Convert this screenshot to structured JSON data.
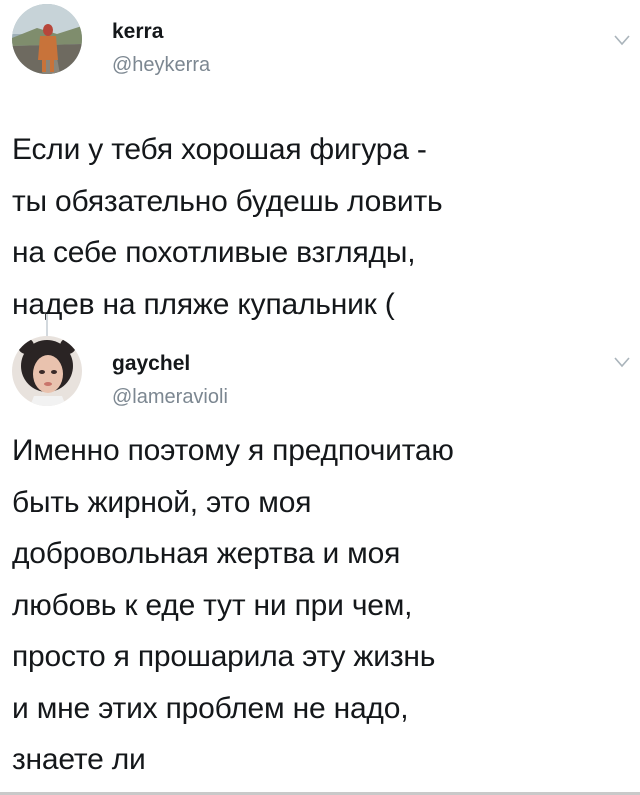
{
  "tweets": [
    {
      "display_name": "kerra",
      "handle": "@heykerra",
      "text": "Если у тебя хорошая фигура -\nты обязательно будешь ловить\nна себе похотливые взгляды,\nнадев на пляже купальник (",
      "avatar_icon": "profile-photo-road",
      "menu_icon": "chevron-down-icon"
    },
    {
      "display_name": "gaychel",
      "handle": "@lameravioli",
      "text": "Именно поэтому я предпочитаю\nбыть жирной, это моя\nдобровольная жертва и моя\nлюбовь к еде тут ни при чем,\nпросто я прошарила эту жизнь\nи мне этих проблем не надо,\nзнаете ли",
      "avatar_icon": "profile-photo-selfie",
      "menu_icon": "chevron-down-icon"
    }
  ],
  "colors": {
    "text": "#14171a",
    "secondary": "#7c8791",
    "thread_line": "#d3d9de"
  }
}
